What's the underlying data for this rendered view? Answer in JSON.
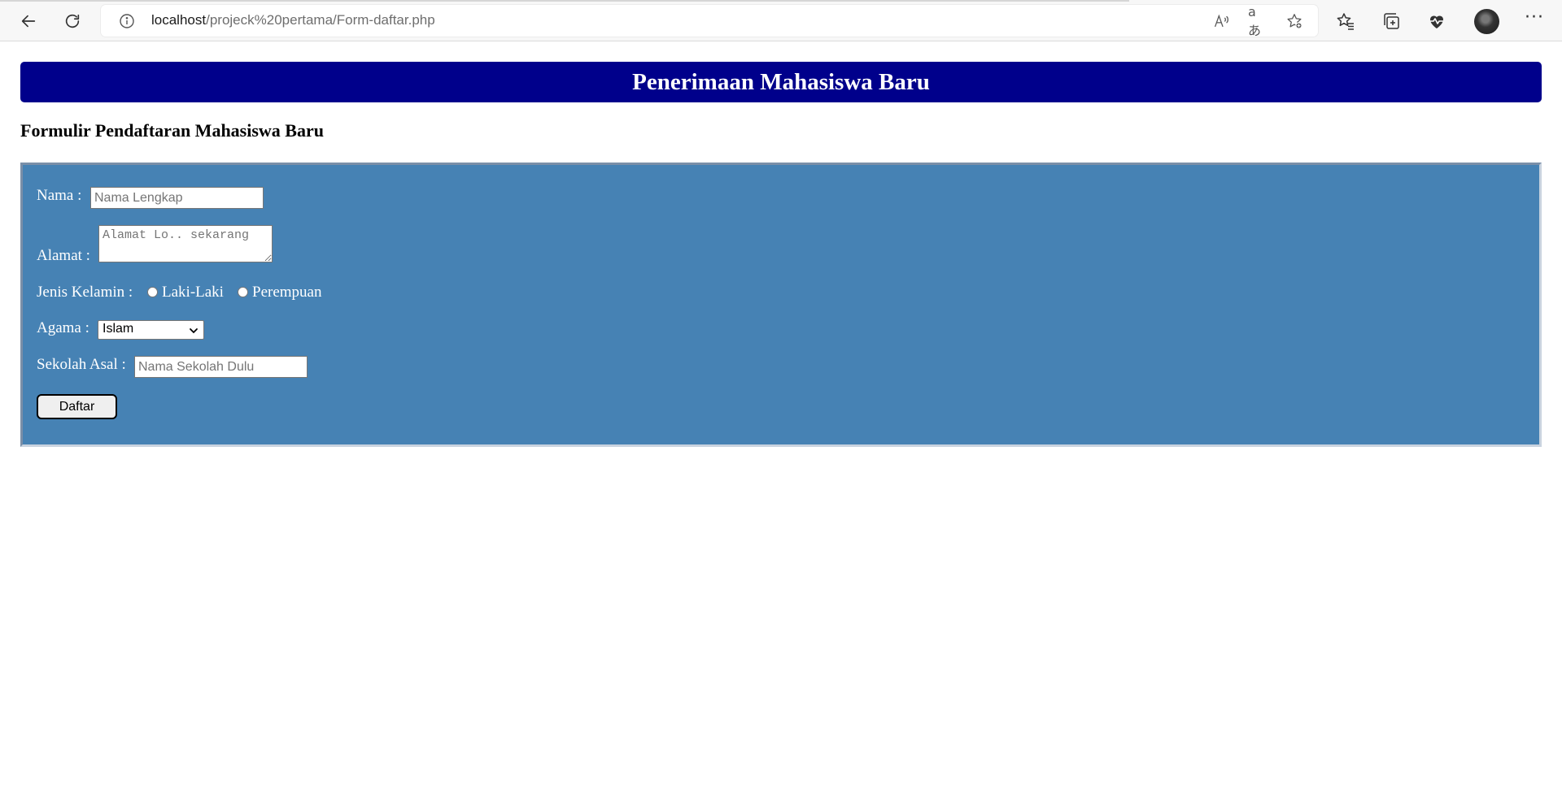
{
  "browser": {
    "url_host": "localhost",
    "url_path": "/projeck%20pertama/Form-daftar.php",
    "icons": {
      "back": "back-arrow-icon",
      "refresh": "refresh-icon",
      "info": "info-icon",
      "read_aloud": "read-aloud-icon",
      "translate": "translate-icon",
      "add_favorite": "add-favorite-icon",
      "favorites": "favorites-icon",
      "collections": "collections-icon",
      "health": "browser-essentials-icon",
      "profile": "avatar",
      "more": "more-options-icon"
    },
    "translate_glyph": "aあ",
    "more_glyph": "···"
  },
  "page": {
    "banner_title": "Penerimaan Mahasiswa Baru",
    "form_heading": "Formulir Pendaftaran Mahasiswa Baru",
    "colors": {
      "banner": "#00008b",
      "panel": "#4682b4"
    }
  },
  "form": {
    "nama": {
      "label": "Nama :",
      "placeholder": "Nama Lengkap",
      "value": ""
    },
    "alamat": {
      "label": "Alamat :",
      "placeholder": "Alamat Lo.. sekarang",
      "value": ""
    },
    "jenis_kelamin": {
      "label": "Jenis Kelamin :",
      "options": [
        "Laki-Laki",
        "Perempuan"
      ],
      "selected": null
    },
    "agama": {
      "label": "Agama :",
      "selected": "Islam"
    },
    "sekolah_asal": {
      "label": "Sekolah Asal :",
      "placeholder": "Nama Sekolah Dulu",
      "value": ""
    },
    "submit_label": "Daftar"
  }
}
